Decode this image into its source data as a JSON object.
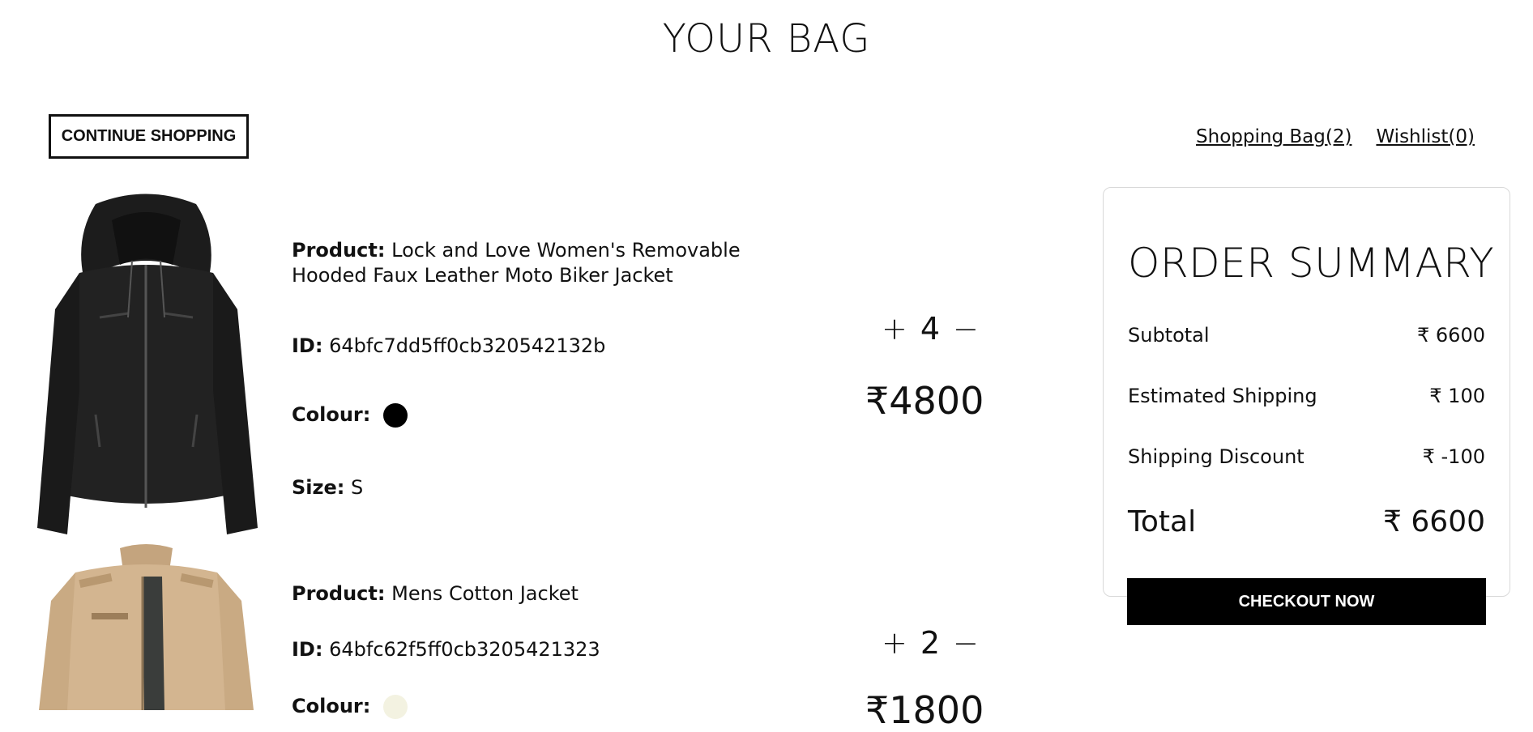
{
  "page": {
    "title": "YOUR BAG"
  },
  "actions": {
    "continue_label": "CONTINUE SHOPPING",
    "checkout_label": "CHECKOUT NOW"
  },
  "links": {
    "bag": "Shopping Bag(2)",
    "wishlist": "Wishlist(0)"
  },
  "labels": {
    "product": "Product:",
    "id": "ID:",
    "colour": "Colour:",
    "size": "Size:"
  },
  "items": [
    {
      "name_line1": "Lock and Love Women's Removable",
      "name_line2": "Hooded Faux Leather Moto Biker Jacket",
      "id": "64bfc7dd5ff0cb320542132b",
      "colour": "#000000",
      "size": "S",
      "qty": "4",
      "price": "₹4800"
    },
    {
      "name_line1": "Mens Cotton Jacket",
      "name_line2": "",
      "id": "64bfc62f5ff0cb3205421323",
      "colour": "#f3f2e1",
      "size": "",
      "qty": "2",
      "price": "₹1800"
    }
  ],
  "qty_controls": {
    "plus": "+",
    "minus": "−"
  },
  "summary": {
    "title": "ORDER SUMMARY",
    "rows": [
      {
        "label": "Subtotal",
        "value": "₹ 6600"
      },
      {
        "label": "Estimated Shipping",
        "value": "₹ 100"
      },
      {
        "label": "Shipping Discount",
        "value": "₹ -100"
      }
    ],
    "total_label": "Total",
    "total_value": "₹ 6600"
  }
}
